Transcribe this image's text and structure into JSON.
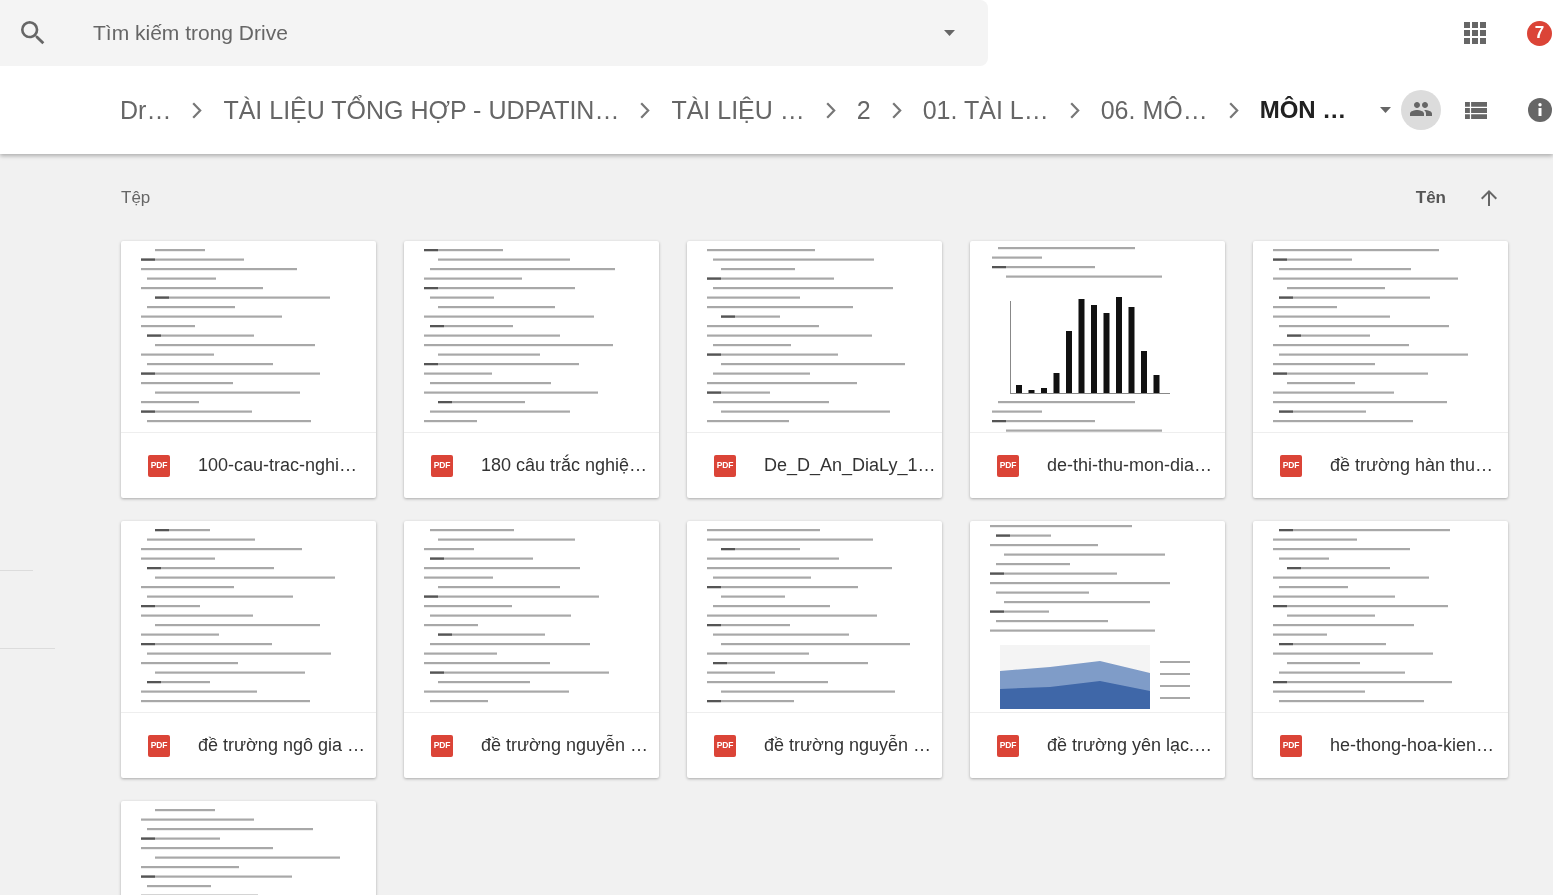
{
  "search": {
    "placeholder": "Tìm kiếm trong Drive"
  },
  "notifications": {
    "count": "7"
  },
  "breadcrumb": [
    {
      "label": "Dr…",
      "current": false
    },
    {
      "label": "TÀI LIỆU TỔNG HỢP - UDPATIN…",
      "current": false
    },
    {
      "label": "TÀI LIỆU …",
      "current": false
    },
    {
      "label": "2",
      "current": false
    },
    {
      "label": "01. TÀI L…",
      "current": false
    },
    {
      "label": "06. MÔ…",
      "current": false
    },
    {
      "label": "MÔN …",
      "current": true
    }
  ],
  "section": {
    "title": "Tệp",
    "sort": {
      "label": "Tên",
      "ascending": true
    }
  },
  "files": [
    {
      "name": "100-cau-trac-nghi…",
      "type_label": "PDF",
      "kind": "text"
    },
    {
      "name": "180 câu trắc nghiệ…",
      "type_label": "PDF",
      "kind": "text"
    },
    {
      "name": "De_D_An_DiaLy_1…",
      "type_label": "PDF",
      "kind": "text"
    },
    {
      "name": "de-thi-thu-mon-dia…",
      "type_label": "PDF",
      "kind": "bar-chart"
    },
    {
      "name": "đề trường hàn thu…",
      "type_label": "PDF",
      "kind": "text"
    },
    {
      "name": "đề trường ngô gia …",
      "type_label": "PDF",
      "kind": "text"
    },
    {
      "name": "đề trường nguyễn …",
      "type_label": "PDF",
      "kind": "text"
    },
    {
      "name": "đề trường nguyễn …",
      "type_label": "PDF",
      "kind": "text"
    },
    {
      "name": "đề trường yên lạc.…",
      "type_label": "PDF",
      "kind": "area-chart"
    },
    {
      "name": "he-thong-hoa-kien…",
      "type_label": "PDF",
      "kind": "text"
    },
    {
      "kind": "text"
    }
  ]
}
